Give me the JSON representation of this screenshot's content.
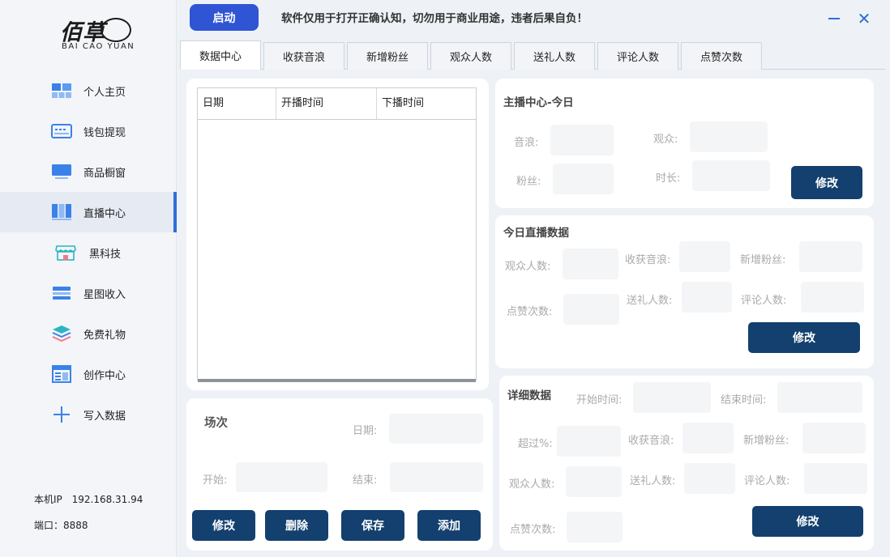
{
  "logo": {
    "mark": "佰草",
    "sub": "BAI CAO YUAN"
  },
  "sidebar": {
    "items": [
      {
        "label": "个人主页"
      },
      {
        "label": "钱包提现"
      },
      {
        "label": "商品橱窗"
      },
      {
        "label": "直播中心"
      },
      {
        "label": "黑科技"
      },
      {
        "label": "星图收入"
      },
      {
        "label": "免费礼物"
      },
      {
        "label": "创作中心"
      },
      {
        "label": "写入数据"
      }
    ],
    "ip_label": "本机IP",
    "ip_value": "192.168.31.94",
    "port_label": "端口：",
    "port_value": "8888"
  },
  "topbar": {
    "start_label": "启动",
    "notice": "软件仅用于打开正确认知，切勿用于商业用途，违者后果自负！"
  },
  "tabs": [
    "数据中心",
    "收获音浪",
    "新增粉丝",
    "观众人数",
    "送礼人数",
    "评论人数",
    "点赞次数"
  ],
  "table": {
    "columns": [
      "日期",
      "开播时间",
      "下播时间"
    ]
  },
  "session": {
    "title": "场次",
    "date_label": "日期:",
    "start_label": "开始:",
    "end_label": "结束:",
    "buttons": {
      "edit": "修改",
      "delete": "删除",
      "save": "保存",
      "add": "添加"
    }
  },
  "anchor_today": {
    "title": "主播中心-今日",
    "yinlang_label": "音浪:",
    "audience_label": "观众:",
    "fans_label": "粉丝:",
    "duration_label": "时长:",
    "edit_label": "修改"
  },
  "live_today": {
    "title": "今日直播数据",
    "audience_label": "观众人数:",
    "yinlang_label": "收获音浪:",
    "newfans_label": "新增粉丝:",
    "likes_label": "点赞次数:",
    "gifters_label": "送礼人数:",
    "comments_label": "评论人数:",
    "edit_label": "修改"
  },
  "detail": {
    "title": "详细数据",
    "start_time_label": "开始时间:",
    "end_time_label": "结束时间:",
    "exceed_label": "超过%:",
    "yinlang_label": "收获音浪:",
    "newfans_label": "新增粉丝:",
    "audience_label": "观众人数:",
    "gifters_label": "送礼人数:",
    "comments_label": "评论人数:",
    "likes_label": "点赞次数:",
    "edit_label": "修改"
  },
  "colors": {
    "accent": "#2d6fd6",
    "start_button": "#2f55d4",
    "dark_button": "#13406e"
  }
}
